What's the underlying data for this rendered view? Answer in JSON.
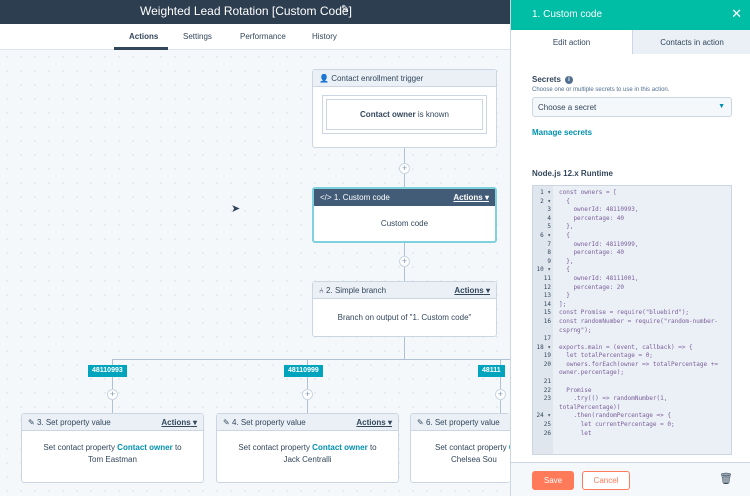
{
  "header": {
    "title": "Weighted Lead Rotation [Custom Code]",
    "edit_icon": "pencil-icon"
  },
  "tabs": [
    "Actions",
    "Settings",
    "Performance",
    "History"
  ],
  "trigger": {
    "title": "Contact enrollment trigger",
    "criteria_bold": "Contact owner",
    "criteria_rest": " is known"
  },
  "custom_code_node": {
    "title": "1. Custom code",
    "actions": "Actions",
    "body": "Custom code"
  },
  "branch_node": {
    "title": "2. Simple branch",
    "actions": "Actions",
    "body": "Branch on output of \"1. Custom code\""
  },
  "branch_tags": [
    "48110993",
    "48110999",
    "48111"
  ],
  "set_nodes": [
    {
      "title": "3. Set property value",
      "actions": "Actions",
      "prefix": "Set contact property ",
      "prop": "Contact owner",
      "to": " to",
      "value": "Tom Eastman"
    },
    {
      "title": "4. Set property value",
      "actions": "Actions",
      "prefix": "Set contact property ",
      "prop": "Contact owner",
      "to": " to",
      "value": "Jack Centralli"
    },
    {
      "title": "6. Set property value",
      "actions": "",
      "prefix": "Set contact property ",
      "prop": "C",
      "to": "",
      "value": "Chelsea Sou"
    }
  ],
  "panel": {
    "title": "1. Custom code",
    "tab_edit": "Edit action",
    "tab_contacts": "Contacts in action",
    "secrets_label": "Secrets",
    "secrets_help": "Choose one or multiple secrets to use in this action.",
    "secrets_placeholder": "Choose a secret",
    "manage_secrets": "Manage secrets",
    "runtime": "Node.js 12.x Runtime",
    "save": "Save",
    "cancel": "Cancel"
  },
  "code_lines": [
    {
      "n": "1 ▾",
      "t": "const owners = ["
    },
    {
      "n": "2 ▾",
      "t": "  {"
    },
    {
      "n": "3",
      "t": "    ownerId: 48110993,"
    },
    {
      "n": "4",
      "t": "    percentage: 40"
    },
    {
      "n": "5",
      "t": "  },"
    },
    {
      "n": "6 ▾",
      "t": "  {"
    },
    {
      "n": "7",
      "t": "    ownerId: 48110999,"
    },
    {
      "n": "8",
      "t": "    percentage: 40"
    },
    {
      "n": "9",
      "t": "  },"
    },
    {
      "n": "10 ▾",
      "t": "  {"
    },
    {
      "n": "11",
      "t": "    ownerId: 48111001,"
    },
    {
      "n": "12",
      "t": "    percentage: 20"
    },
    {
      "n": "13",
      "t": "  }"
    },
    {
      "n": "14",
      "t": "];"
    },
    {
      "n": "15",
      "t": "const Promise = require(\"bluebird\");"
    },
    {
      "n": "16",
      "t": "const randomNumber = require(\"random-number-"
    },
    {
      "n": "",
      "t": "csprng\");"
    },
    {
      "n": "17",
      "t": ""
    },
    {
      "n": "18 ▾",
      "t": "exports.main = (event, callback) => {"
    },
    {
      "n": "19",
      "t": "  let totalPercentage = 0;"
    },
    {
      "n": "20",
      "t": "  owners.forEach(owner => totalPercentage +="
    },
    {
      "n": "",
      "t": "owner.percentage);"
    },
    {
      "n": "21",
      "t": ""
    },
    {
      "n": "22",
      "t": "  Promise"
    },
    {
      "n": "23",
      "t": "    .try(() => randomNumber(1,"
    },
    {
      "n": "",
      "t": "totalPercentage))"
    },
    {
      "n": "24 ▾",
      "t": "    .then(randomPercentage => {"
    },
    {
      "n": "25",
      "t": "      let currentPercentage = 0;"
    },
    {
      "n": "26",
      "t": "      let"
    }
  ]
}
